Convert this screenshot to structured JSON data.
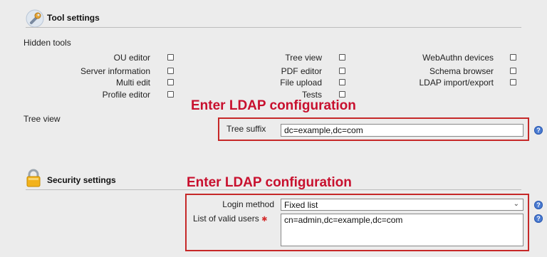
{
  "tool_settings": {
    "title": "Tool settings",
    "icon": "wrench-icon",
    "hidden_tools_label": "Hidden tools",
    "tools_col1": [
      "OU editor",
      "Server information",
      "Multi edit",
      "Profile editor"
    ],
    "tools_col2": [
      "Tree view",
      "PDF editor",
      "File upload",
      "Tests"
    ],
    "tools_col3": [
      "WebAuthn devices",
      "Schema browser",
      "LDAP import/export"
    ],
    "tree_view_label": "Tree view",
    "tree_suffix_label": "Tree suffix",
    "tree_suffix_value": "dc=example,dc=com"
  },
  "security_settings": {
    "title": "Security settings",
    "icon": "lock-icon",
    "login_method_label": "Login method",
    "login_method_value": "Fixed list",
    "valid_users_label": "List of valid users",
    "valid_users_value": "cn=admin,dc=example,dc=com"
  },
  "annotations": {
    "first": "Enter LDAP configuration",
    "second": "Enter LDAP configuration",
    "color": "#c8102e"
  }
}
